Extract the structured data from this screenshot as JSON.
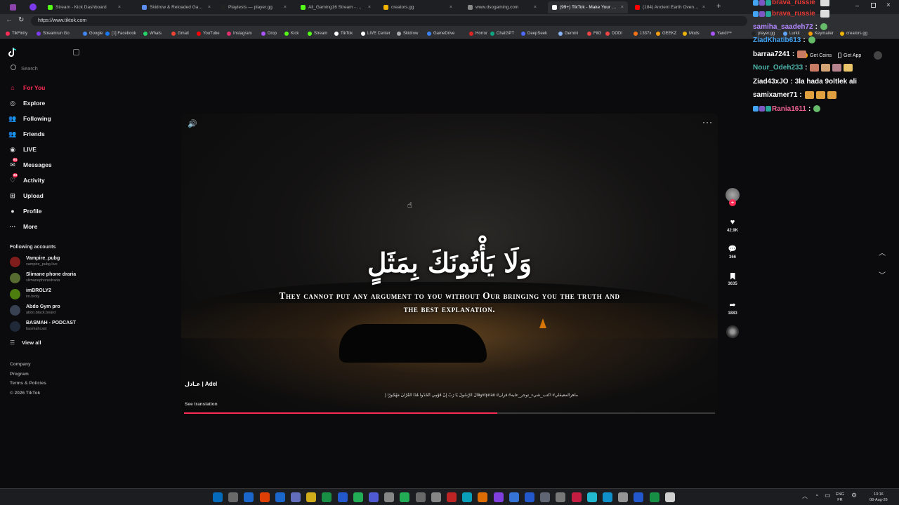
{
  "browser": {
    "tabs": [
      {
        "label": "Stream - Kick Dashboard",
        "color": "#53fc18"
      },
      {
        "label": "Skidrow & Reloaded Games – Do",
        "color": "#5a8dee"
      },
      {
        "label": "Playtests — player.gg",
        "color": "#222222"
      },
      {
        "label": "Ali_Gaming16 Stream - Watch Liv",
        "color": "#53fc18"
      },
      {
        "label": "creators.gg",
        "color": "#f0b400"
      },
      {
        "label": "www.dsogaming.com",
        "color": "#888888"
      },
      {
        "label": "(99+) TikTok - Make Your Day",
        "color": "#ffffff",
        "active": true
      },
      {
        "label": "(184) Ancient Earth Oven! Cooking",
        "color": "#ff0000"
      }
    ],
    "url": "https://www.tiktok.com",
    "bookmarks": [
      {
        "label": "TikFinity",
        "color": "#fe2c55"
      },
      {
        "label": "Streamrun Go",
        "color": "#7c3aed"
      },
      {
        "label": "Google",
        "color": "#4285f4"
      },
      {
        "label": "[1] Facebook",
        "color": "#1877f2"
      },
      {
        "label": "Whats",
        "color": "#25d366"
      },
      {
        "label": "Gmail",
        "color": "#ea4335"
      },
      {
        "label": "YouTube",
        "color": "#ff0000"
      },
      {
        "label": "Instagram",
        "color": "#e1306c"
      },
      {
        "label": "Drop",
        "color": "#a855f7"
      },
      {
        "label": "Kick",
        "color": "#53fc18"
      },
      {
        "label": "Stream",
        "color": "#53fc18"
      },
      {
        "label": "TikTok",
        "color": "#ffffff"
      },
      {
        "label": "LIVE Center",
        "color": "#ffffff"
      },
      {
        "label": "Skidrow",
        "color": "#aaaaaa"
      },
      {
        "label": "GameDrive",
        "color": "#3b82f6"
      },
      {
        "label": "Horror",
        "color": "#dc2626"
      },
      {
        "label": "ChatGPT",
        "color": "#10a37f"
      },
      {
        "label": "DeepSeek",
        "color": "#4d6bfe"
      },
      {
        "label": "Gemini",
        "color": "#8ab4f8"
      },
      {
        "label": "FitG",
        "color": "#ef4444"
      },
      {
        "label": "DODI",
        "color": "#ef4444"
      },
      {
        "label": "1337x",
        "color": "#f97316"
      },
      {
        "label": "GEEKZ",
        "color": "#f59e0b"
      },
      {
        "label": "Mods",
        "color": "#eab308"
      },
      {
        "label": "Yandi™",
        "color": "#a855f7"
      },
      {
        "label": "player.gg",
        "color": "#222222"
      },
      {
        "label": "Lurkit",
        "color": "#60a5fa"
      },
      {
        "label": "Keymailer",
        "color": "#f59e0b"
      },
      {
        "label": "creators.gg",
        "color": "#f0b400"
      }
    ]
  },
  "tiktok": {
    "search_placeholder": "Search",
    "nav": [
      {
        "label": "For You",
        "icon": "home-icon",
        "active": true
      },
      {
        "label": "Explore",
        "icon": "compass-icon"
      },
      {
        "label": "Following",
        "icon": "following-icon"
      },
      {
        "label": "Friends",
        "icon": "friends-icon"
      },
      {
        "label": "LIVE",
        "icon": "live-icon"
      },
      {
        "label": "Messages",
        "icon": "messages-icon",
        "badge": "84"
      },
      {
        "label": "Activity",
        "icon": "activity-icon",
        "badge": "33"
      },
      {
        "label": "Upload",
        "icon": "upload-icon"
      },
      {
        "label": "Profile",
        "icon": "profile-icon"
      },
      {
        "label": "More",
        "icon": "more-icon"
      }
    ],
    "following_header": "Following accounts",
    "accounts": [
      {
        "name": "Vampire_pubg",
        "handle": "vampire_pubg.live",
        "color": "#7f1d1d"
      },
      {
        "name": "Slimane phone draria",
        "handle": "slimanephonedraria",
        "color": "#556b2f"
      },
      {
        "name": "imBROLY2",
        "handle": "im.broly",
        "color": "#4d7c0f"
      },
      {
        "name": "Abdo Gym pro",
        "handle": "abdo.black.beard",
        "color": "#374151"
      },
      {
        "name": "BASMAH - PODCAST",
        "handle": "basmahcast",
        "color": "#1f2937"
      }
    ],
    "view_all": "View all",
    "footer": [
      "Company",
      "Program",
      "Terms & Policies",
      "© 2026 TikTok"
    ],
    "video": {
      "arabic_text": "وَلَا يَأْتُونَكَ بِمَثَلٍ",
      "english_text": "They cannot put any argument to you without Our bringing you the truth and the best explanation.",
      "author": "عـادل | Adel",
      "caption": "ماهرالمعيقلي# اكتب_شيء_توجر_عليه# قران# quran#وَقَالَ الرَّسُولُ يَا رَبِّ إِنَّ قَوْمِي اتَّخَذُوا هَٰذَا الْقُرْآنَ مَهْجُورًا (",
      "see_translation": "See translation",
      "progress": 0.59
    },
    "actions": {
      "likes": "42.9K",
      "comments": "366",
      "saves": "3635",
      "shares": "1883"
    },
    "get_coins": "Get Coins",
    "get_app": "Get App"
  },
  "chat": [
    {
      "user": "brava_russie",
      "color": "#e53935",
      "message": ""
    },
    {
      "user": "brava_russie",
      "color": "#e53935",
      "message": ""
    },
    {
      "user": "samiha_saadeh72",
      "color": "#b388ff",
      "message": ":"
    },
    {
      "user": "ZiadKhatib613",
      "color": "#42a5f5",
      "message": ":"
    },
    {
      "user": "barraa7241",
      "color": "#ffffff",
      "message": ":"
    },
    {
      "user": "Nour_Odeh233",
      "color": "#4db6ac",
      "message": ":"
    },
    {
      "user": "Ziad43xJO",
      "color": "#ffffff",
      "message": ": 3la hada 9oltlek ali"
    },
    {
      "user": "samixamer71",
      "color": "#ffffff",
      "message": ":"
    },
    {
      "user": "Rania1611",
      "color": "#f06292",
      "message": ":"
    }
  ],
  "taskbar": {
    "lang_top": "ENG",
    "lang_bottom": "FR",
    "time": "13:16",
    "date": "08-Aug-26"
  }
}
